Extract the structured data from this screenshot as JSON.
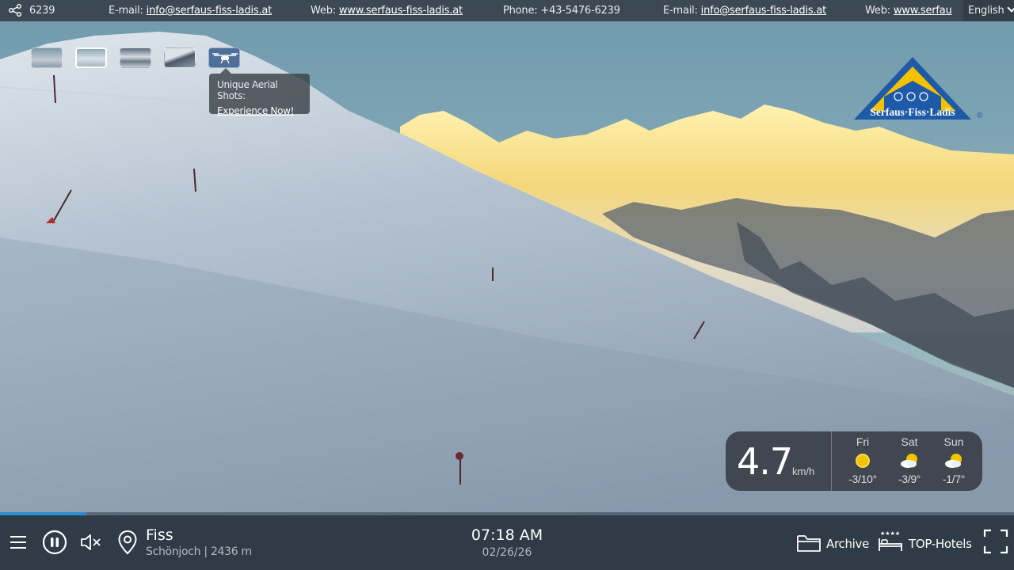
{
  "ticker": {
    "share_count": "6239",
    "items": [
      {
        "label": "E-mail: ",
        "link": "info@serfaus-fiss-ladis.at"
      },
      {
        "label": "Web: ",
        "link": "www.serfaus-fiss-ladis.at"
      },
      {
        "label": "Phone: +43-5476-6239",
        "link": ""
      },
      {
        "label": "E-mail: ",
        "link": "info@serfaus-fiss-ladis.at"
      },
      {
        "label": "Web: ",
        "link": "www.serfau"
      }
    ],
    "language": "English"
  },
  "thumbnails": {
    "count": 5,
    "active_index": 1,
    "tooltip_title": "Unique Aerial Shots:",
    "tooltip_link": "Experience Now!"
  },
  "logo": {
    "text": "Serfaus·Fiss·Ladis",
    "registered": "®",
    "brand_blue": "#1e5aa8",
    "brand_yellow": "#f2c200"
  },
  "weather": {
    "wind_speed": "4.7",
    "wind_unit": "km/h",
    "days": [
      {
        "name": "Fri",
        "icon": "sun-icon",
        "temps": "-3/10°"
      },
      {
        "name": "Sat",
        "icon": "sun-cloud-icon",
        "temps": "-3/9°"
      },
      {
        "name": "Sun",
        "icon": "sun-cloud-icon",
        "temps": "-1/7°"
      }
    ]
  },
  "progress": {
    "fraction": 0.085,
    "color": "#2d8cd0"
  },
  "bottom": {
    "location": "Fiss",
    "sublocation": "Schönjoch | 2436 m",
    "time": "07:18 AM",
    "date": "02/26/26",
    "archive_label": "Archive",
    "hotels_label": "TOP-Hotels"
  }
}
